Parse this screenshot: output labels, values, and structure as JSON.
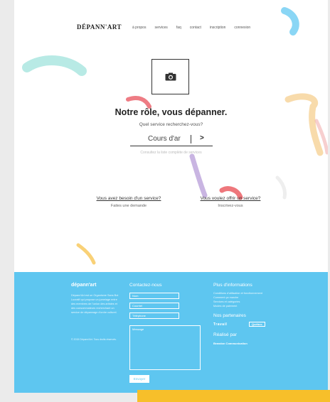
{
  "nav": {
    "logo": "DÉPANN'ART",
    "links": [
      "à propos",
      "services",
      "faq",
      "contact",
      "inscription",
      "connexion"
    ]
  },
  "hero": {
    "camera_icon": "camera-icon",
    "title": "Notre rôle, vous dépanner.",
    "subtitle": "Quel service recherchez-vous?",
    "search_value": "Cours d'ar",
    "search_go": ">",
    "hint": "Consultez la liste complète de services"
  },
  "cta": {
    "left_question": "Vous avez besoin d'un service?",
    "left_action": "Faites une demande",
    "right_question": "Vous voulez offrir un service?",
    "right_action": "Inscrivez-vous"
  },
  "footer": {
    "brand": "dépann'art",
    "description": "Dépann'Art est un Organisme Sans But Lucratif qui propose un jumelage entre des membres de l'union des artistes et des consommateurs recherchant un service de dépannage d'ordre culturel.",
    "copyright": "© 2015 Dépann'Art. Tous droits réservés.",
    "contact_title": "Contactez-nous",
    "field_name": "Nom",
    "field_email": "Courriel",
    "field_phone": "Téléphone",
    "field_message": "Message",
    "submit": "Envoyer",
    "info_title": "Plus d'informations",
    "info_links": [
      "Conditions d'utilisation et fonctionnement",
      "Comment ça marche",
      "Services et catégories",
      "Modes de paiement"
    ],
    "partners_title": "Nos partenaires",
    "partner_1": "Travail",
    "partner_2": "Québec",
    "realise_title": "Réalisé par",
    "realise_name": "Brandon Communication"
  },
  "colors": {
    "footer_bg": "#5ec6f0",
    "accent_yellow": "#f7bf2a",
    "page_bg": "#ffffff"
  }
}
